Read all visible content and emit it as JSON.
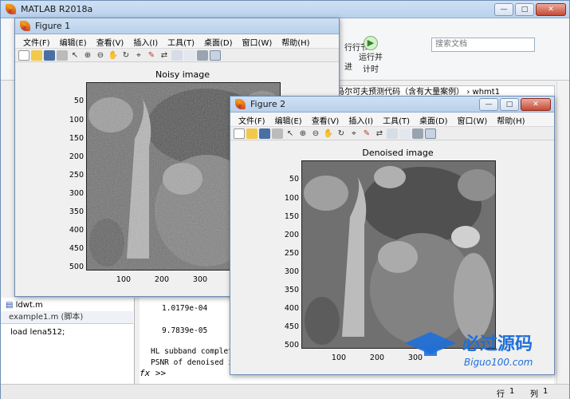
{
  "main": {
    "title": "MATLAB R2018a",
    "search_placeholder": "搜索文档",
    "toolstrip": {
      "btn_run_section": "行行节",
      "btn_run_advance": "运行并",
      "btn_run_advance2": "计时",
      "btn_advance": "进"
    },
    "address": "› 隐马尔可夫预测代码（含有大量案例） › whmt1",
    "current_file": "ldwt.m",
    "file_detail": "example1.m  (脚本)",
    "detail_code": "load lena512;",
    "command_lines": [
      "1.0179e-04",
      "9.7839e-05",
      "HL subband completed",
      "PSNR of denoised ima"
    ],
    "prompt_symbol": "fx >>",
    "status": {
      "row_label": "行",
      "row_value": "1",
      "col_label": "列",
      "col_value": "1"
    }
  },
  "figure1": {
    "title": "Figure 1",
    "menu": [
      "文件(F)",
      "编辑(E)",
      "查看(V)",
      "插入(I)",
      "工具(T)",
      "桌面(D)",
      "窗口(W)",
      "帮助(H)"
    ],
    "axes_title": "Noisy image",
    "yticks": [
      "50",
      "100",
      "150",
      "200",
      "250",
      "300",
      "350",
      "400",
      "450",
      "500"
    ],
    "xticks": [
      "100",
      "200",
      "300"
    ]
  },
  "figure2": {
    "title": "Figure 2",
    "menu": [
      "文件(F)",
      "编辑(E)",
      "查看(V)",
      "插入(I)",
      "工具(T)",
      "桌面(D)",
      "窗口(W)",
      "帮助(H)"
    ],
    "axes_title": "Denoised image",
    "yticks": [
      "50",
      "100",
      "150",
      "200",
      "250",
      "300",
      "350",
      "400",
      "450",
      "500"
    ],
    "xticks": [
      "100",
      "200",
      "300"
    ]
  },
  "watermark": {
    "brand": "必过源码",
    "url": "Biguo100.com"
  },
  "colors": {
    "titlebar": "#b9d1ec",
    "close": "#c74a36",
    "watermark": "#1e6fd9"
  }
}
